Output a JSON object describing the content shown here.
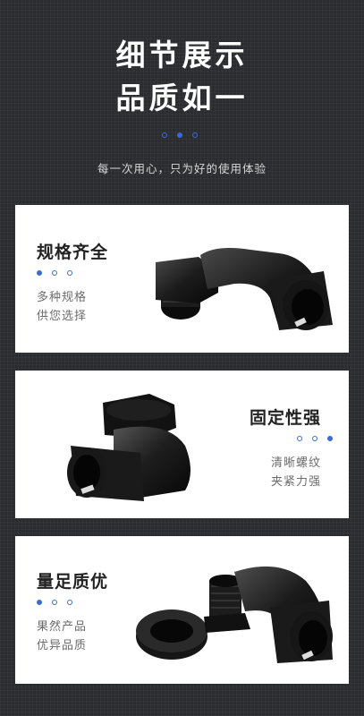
{
  "hero": {
    "title_line1": "细节展示",
    "title_line2": "品质如一",
    "subtitle": "每一次用心，只为好的使用体验"
  },
  "cards": [
    {
      "title": "规格齐全",
      "line1": "多种规格",
      "line2": "供您选择"
    },
    {
      "title": "固定性强",
      "line1": "清晰螺纹",
      "line2": "夹紧力强"
    },
    {
      "title": "量足质优",
      "line1": "果然产品",
      "line2": "优异品质"
    }
  ],
  "colors": {
    "accent": "#3b6ad8",
    "card_bg": "#ffffff",
    "page_bg": "#2a2c30"
  },
  "images": [
    "elbow-fitting-with-nut",
    "elbow-fitting-angle-view",
    "elbow-fitting-with-separate-locknut"
  ]
}
